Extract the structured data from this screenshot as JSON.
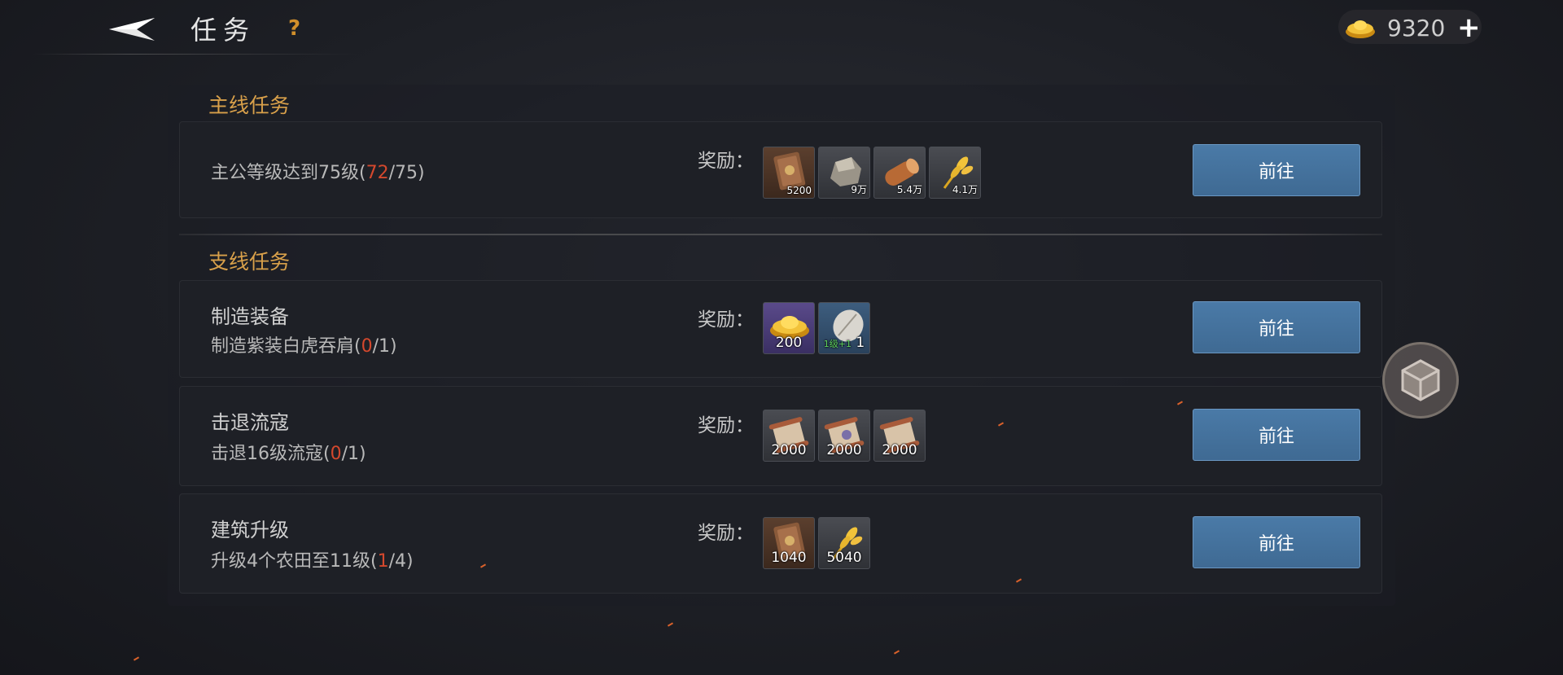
{
  "header": {
    "title": "任务",
    "help": "?",
    "currency": {
      "value": "9320",
      "plus": "+"
    }
  },
  "main_section": {
    "title": "主线任务",
    "task": {
      "desc_prefix": "主公等级达到75级(",
      "progress_current": "72",
      "progress_rest": "/75)",
      "reward_label": "奖励：",
      "rewards": [
        {
          "icon": "book-icon",
          "qty": "5200"
        },
        {
          "icon": "stone-icon",
          "qty": "9万"
        },
        {
          "icon": "wood-icon",
          "qty": "5.4万"
        },
        {
          "icon": "wheat-icon",
          "qty": "4.1万"
        }
      ],
      "button": "前往"
    }
  },
  "side_section": {
    "title": "支线任务",
    "tasks": [
      {
        "name": "制造装备",
        "desc_prefix": "制造紫装白虎吞肩(",
        "progress_current": "0",
        "progress_rest": "/1)",
        "reward_label": "奖励：",
        "rewards": [
          {
            "icon": "gold-ingot-icon",
            "qty": "200"
          },
          {
            "icon": "badge-icon",
            "qty": "1",
            "sublabel": "1级+1"
          }
        ],
        "button": "前往"
      },
      {
        "name": "击退流寇",
        "desc_prefix": "击退16级流寇(",
        "progress_current": "0",
        "progress_rest": "/1)",
        "reward_label": "奖励：",
        "rewards": [
          {
            "icon": "scroll-icon",
            "qty": "2000"
          },
          {
            "icon": "scroll-icon",
            "qty": "2000"
          },
          {
            "icon": "scroll-icon",
            "qty": "2000"
          }
        ],
        "button": "前往"
      },
      {
        "name": "建筑升级",
        "desc_prefix": "升级4个农田至11级(",
        "progress_current": "1",
        "progress_rest": "/4)",
        "reward_label": "奖励：",
        "rewards": [
          {
            "icon": "book-icon",
            "qty": "1040"
          },
          {
            "icon": "wheat-icon",
            "qty": "5040"
          }
        ],
        "button": "前往"
      }
    ]
  },
  "colors": {
    "accent": "#d8a04a",
    "progress_highlight": "#d4482d",
    "button": "#4a7aa7"
  }
}
